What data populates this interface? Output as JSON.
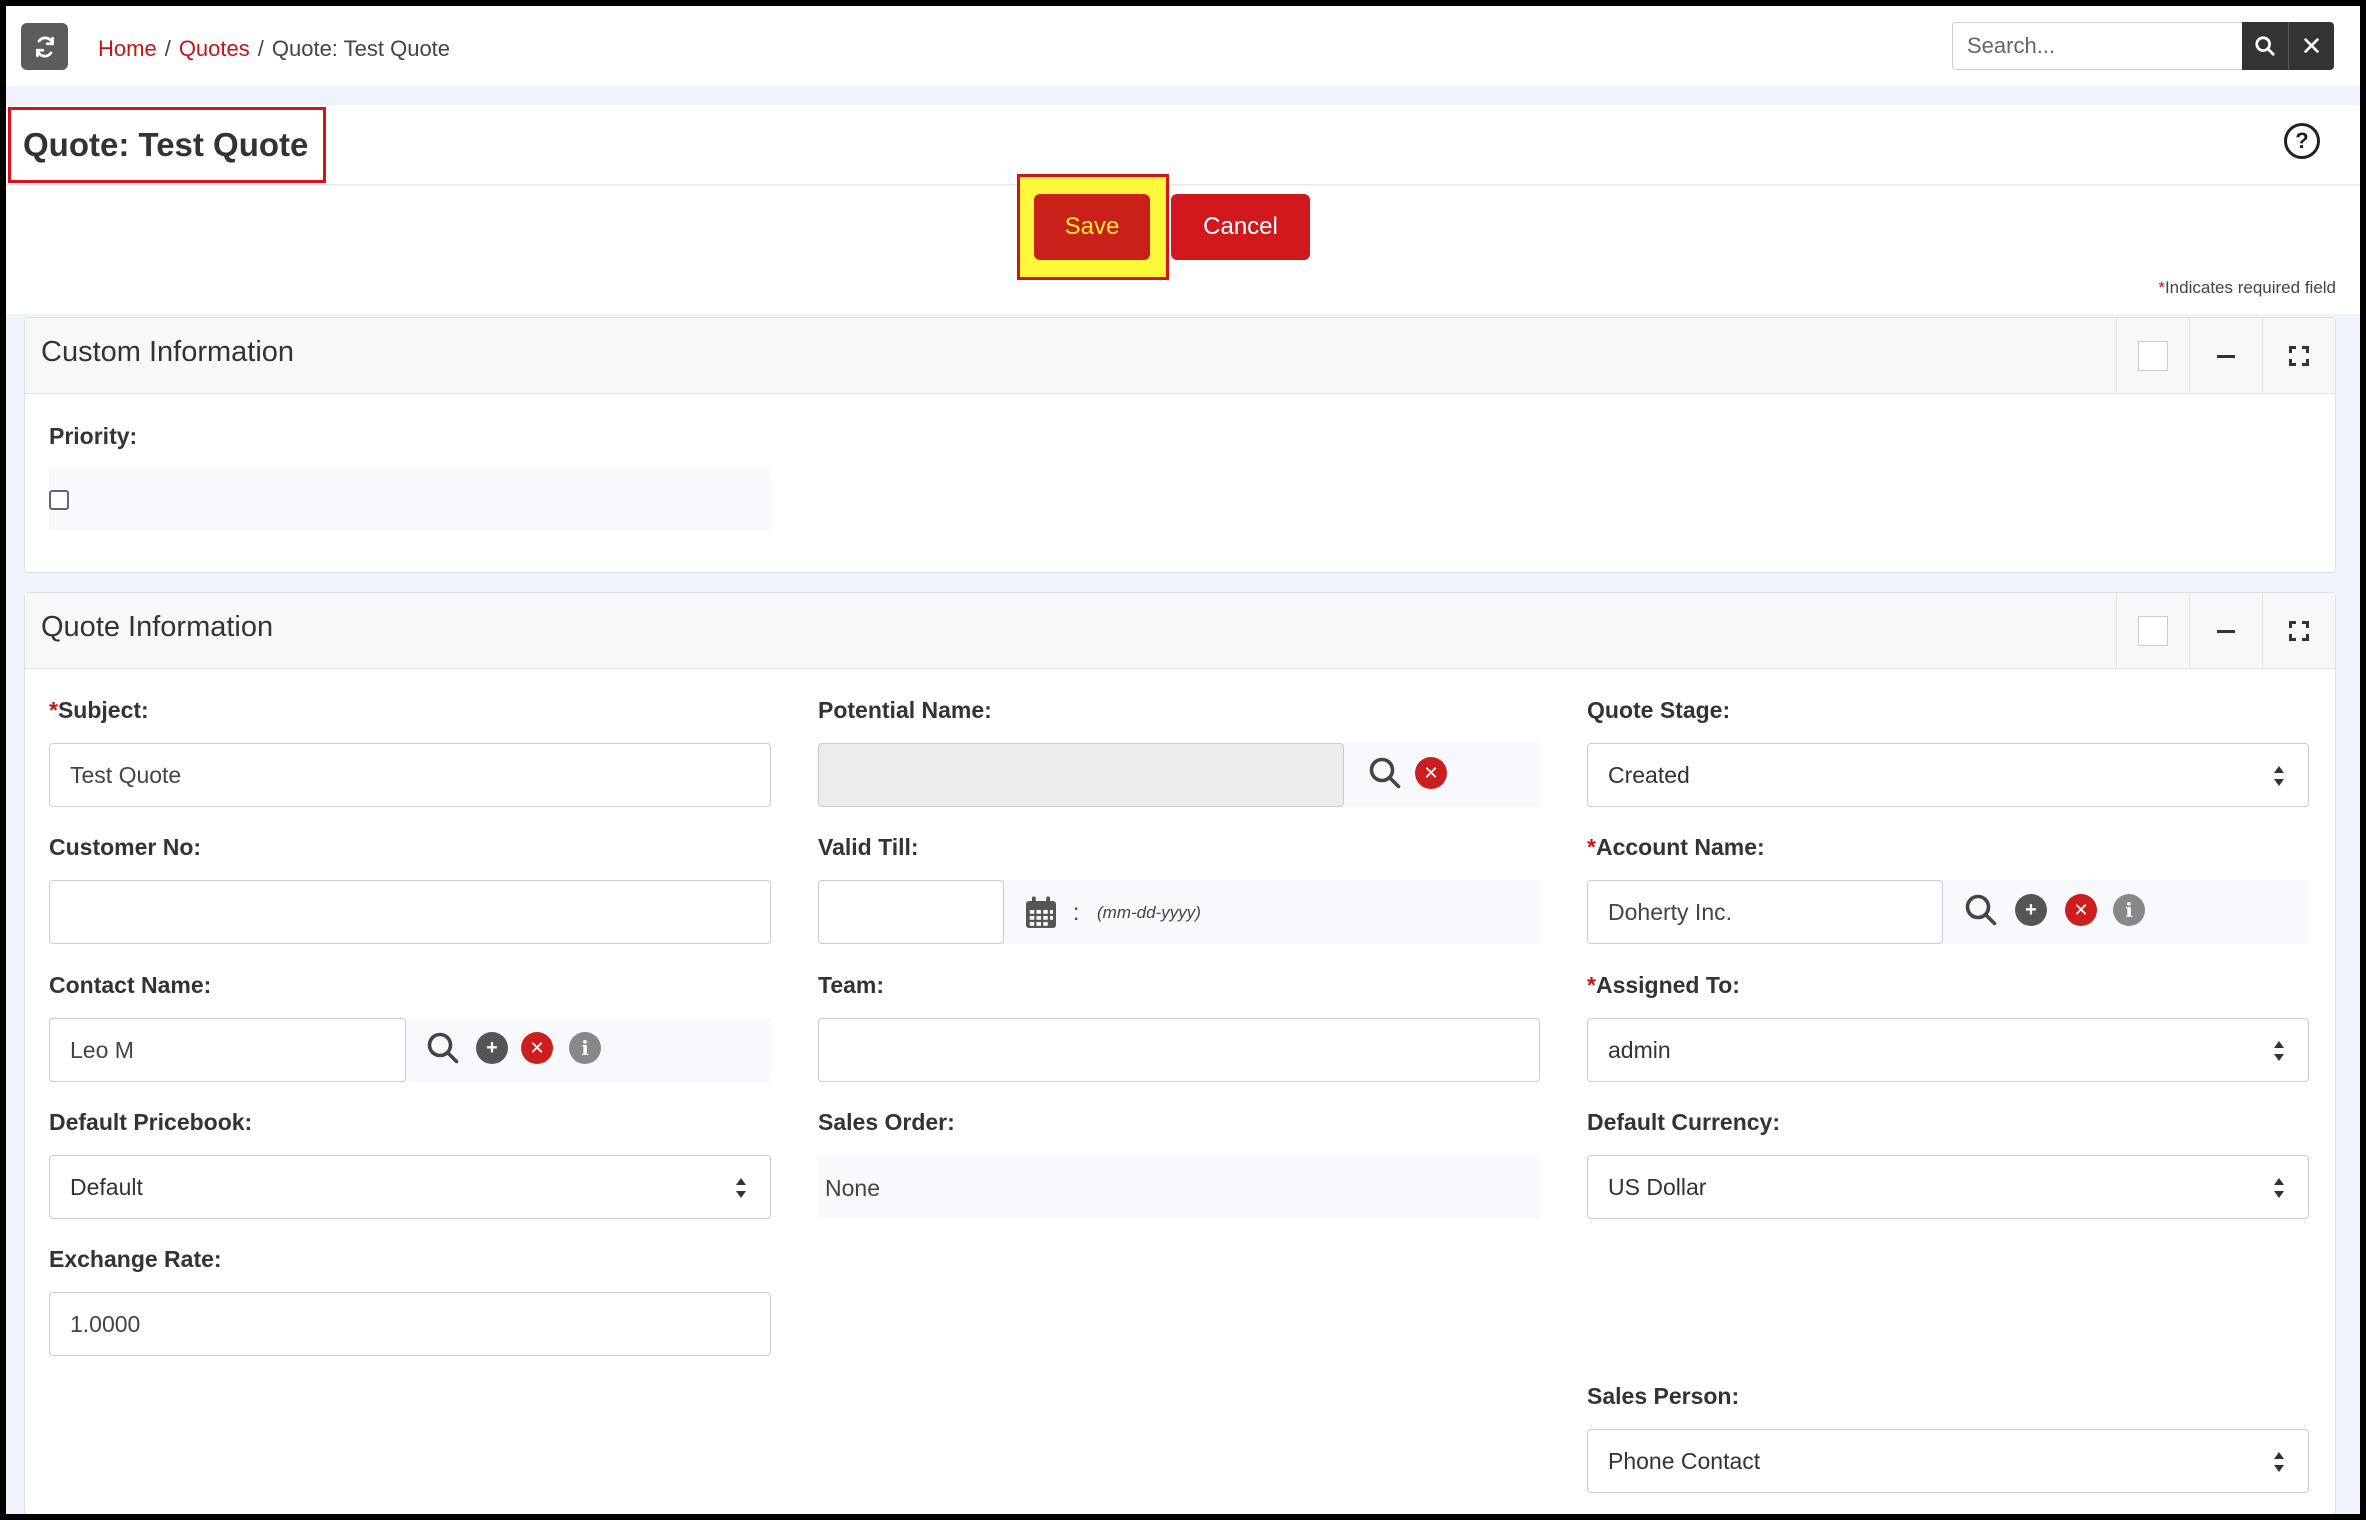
{
  "breadcrumb": {
    "home": "Home",
    "sep": "/",
    "quotes": "Quotes",
    "current": "Quote: Test Quote"
  },
  "search": {
    "placeholder": "Search...",
    "clear_symbol": "✕"
  },
  "header": {
    "title": "Quote: Test Quote",
    "help_symbol": "?"
  },
  "actions": {
    "save_label": "Save",
    "cancel_label": "Cancel",
    "required_star": "*",
    "required_note": "Indicates required field"
  },
  "custom_panel": {
    "title": "Custom Information",
    "priority_label": "Priority:",
    "priority_checked": false
  },
  "quote_panel": {
    "title": "Quote Information",
    "subject_label": "Subject:",
    "subject_value": "Test Quote",
    "potential_label": "Potential Name:",
    "potential_value": "",
    "stage_label": "Quote Stage:",
    "stage_value": "Created",
    "customer_no_label": "Customer No:",
    "customer_no_value": "",
    "valid_till_label": "Valid Till:",
    "valid_till_value": "",
    "date_sep": ":",
    "date_format": "(mm-dd-yyyy)",
    "account_label": "Account Name:",
    "account_value": "Doherty Inc.",
    "contact_label": "Contact Name:",
    "contact_value": "Leo M",
    "team_label": "Team:",
    "team_value": "",
    "assigned_label": "Assigned To:",
    "assigned_value": "admin",
    "pricebook_label": "Default Pricebook:",
    "pricebook_value": "Default",
    "sales_order_label": "Sales Order:",
    "sales_order_value": "None",
    "currency_label": "Default Currency:",
    "currency_value": "US Dollar",
    "exchange_label": "Exchange Rate:",
    "exchange_value": "1.0000",
    "sales_person_label": "Sales Person:",
    "sales_person_value": "Phone Contact"
  },
  "icons": {
    "plus": "+",
    "clear": "✕",
    "info": "i"
  },
  "colors": {
    "accent_red": "#c9211a",
    "link_red": "#c0171b",
    "highlight_yellow": "#fff83b"
  }
}
